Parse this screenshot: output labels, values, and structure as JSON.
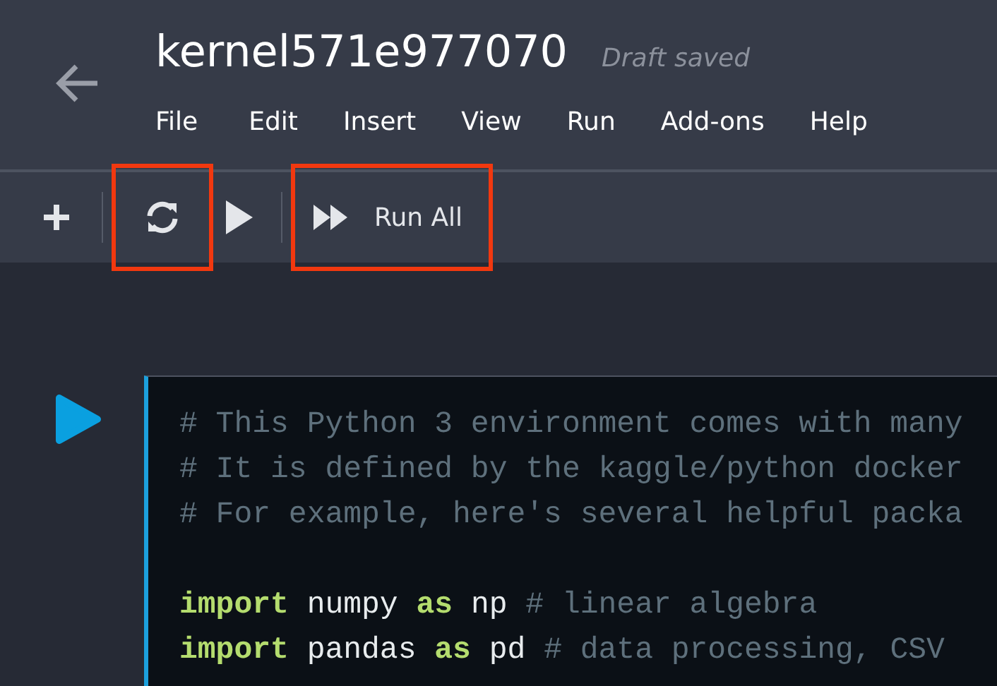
{
  "header": {
    "title": "kernel571e977070",
    "save_status": "Draft saved",
    "menu": [
      "File",
      "Edit",
      "Insert",
      "View",
      "Run",
      "Add-ons",
      "Help"
    ]
  },
  "toolbar": [
    {
      "kind": "add",
      "highlighted": false
    },
    {
      "kind": "divider"
    },
    {
      "kind": "restart",
      "highlighted": true
    },
    {
      "kind": "run",
      "highlighted": false
    },
    {
      "kind": "divider"
    },
    {
      "kind": "run_all",
      "label": "Run All",
      "highlighted": true
    }
  ],
  "cell": {
    "selected": true,
    "lines": [
      [
        {
          "kind": "comment",
          "text": "# This Python 3 environment comes with many"
        }
      ],
      [
        {
          "kind": "comment",
          "text": "# It is defined by the kaggle/python docker"
        }
      ],
      [
        {
          "kind": "comment",
          "text": "# For example, here's several helpful packa"
        }
      ],
      [
        {
          "kind": "keyword",
          "text": "import"
        },
        {
          "kind": "name",
          "text": " numpy "
        },
        {
          "kind": "keyword",
          "text": "as"
        },
        {
          "kind": "name",
          "text": " np "
        },
        {
          "kind": "comment",
          "text": "# linear algebra"
        },
        {
          "kind": "gap_before"
        }
      ],
      [
        {
          "kind": "keyword",
          "text": "import"
        },
        {
          "kind": "name",
          "text": " pandas "
        },
        {
          "kind": "keyword",
          "text": "as"
        },
        {
          "kind": "name",
          "text": " pd "
        },
        {
          "kind": "comment",
          "text": "# data processing, CSV"
        }
      ]
    ]
  }
}
